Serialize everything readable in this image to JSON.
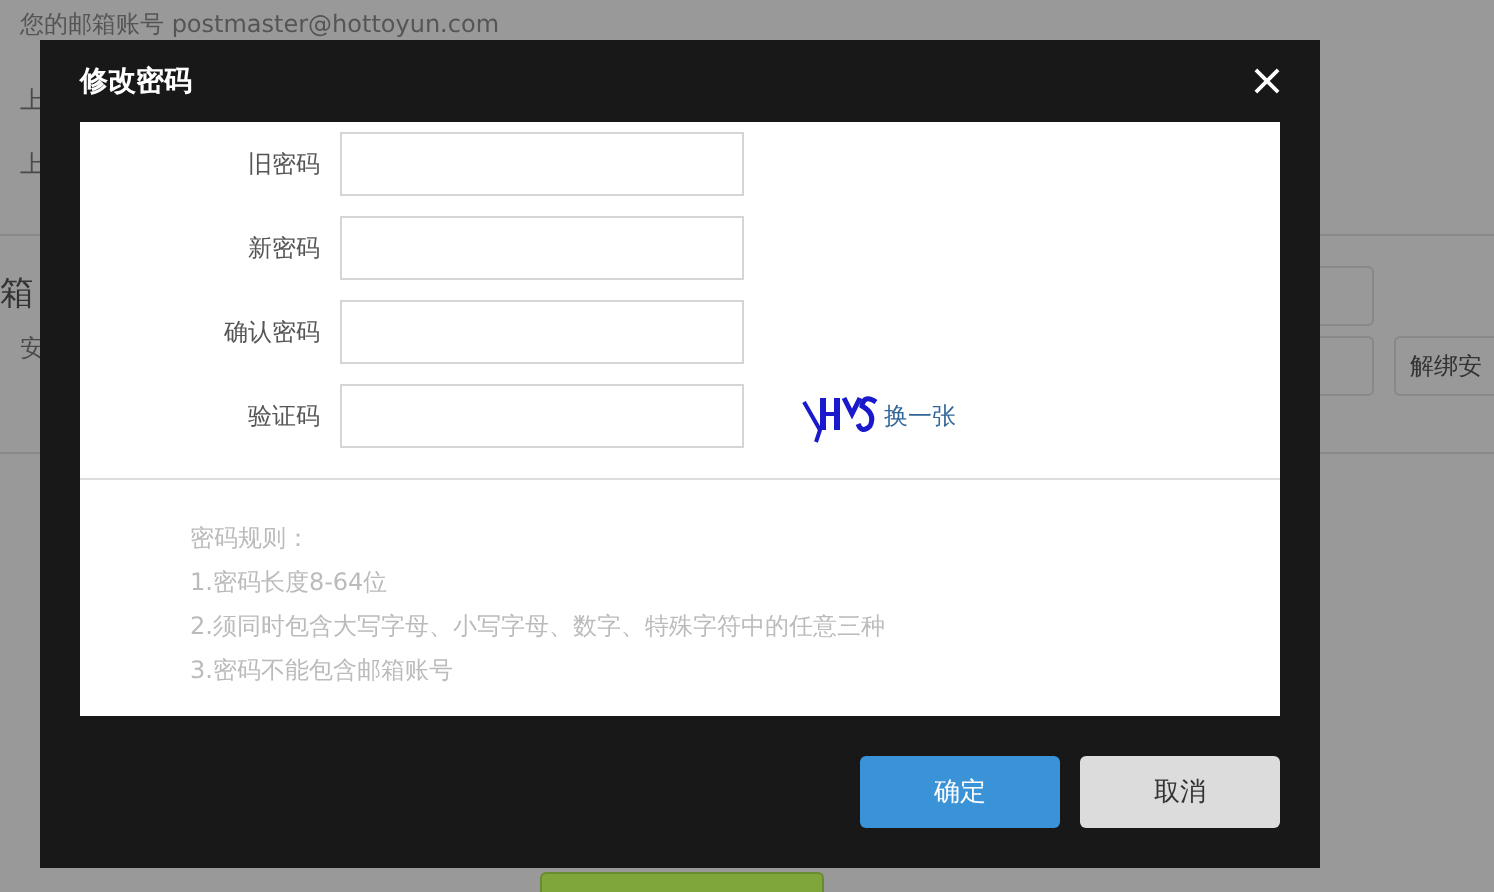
{
  "page": {
    "account_line": "您的邮箱账号 postmaster@hottoyun.com",
    "lines": [
      "上",
      "上"
    ],
    "section_title": "箱",
    "section_text": "安",
    "button": "解绑安"
  },
  "dialog": {
    "title": "修改密码",
    "fields": [
      {
        "label": "旧密码",
        "kind": "text"
      },
      {
        "label": "新密码",
        "kind": "text"
      },
      {
        "label": "确认密码",
        "kind": "text"
      },
      {
        "label": "验证码",
        "kind": "captcha",
        "refresh": "换一张"
      }
    ],
    "rules": [
      "密码规则：",
      "1.密码长度8-64位",
      "2.须同时包含大写字母、小写字母、数字、特殊字符中的任意三种",
      "3.密码不能包含邮箱账号"
    ],
    "buttons": [
      {
        "label": "确定",
        "kind": "primary"
      },
      {
        "label": "取消",
        "kind": "secondary"
      }
    ]
  }
}
